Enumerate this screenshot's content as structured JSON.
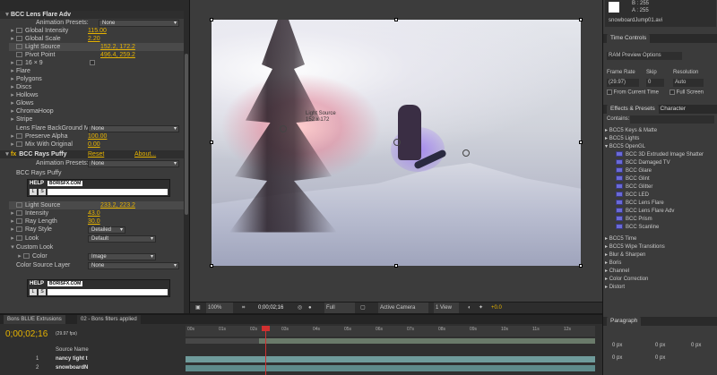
{
  "effects": {
    "bcc_flare_header": "BCC Lens Flare Adv",
    "animation_presets_label": "Animation Presets:",
    "animation_presets_value": "None",
    "global_intensity": {
      "label": "Global Intensity",
      "value": "115.00"
    },
    "global_scale": {
      "label": "Global Scale",
      "value": "2.20"
    },
    "light_source": {
      "label": "Light Source",
      "value": "152.2, 172.2"
    },
    "pivot_point": {
      "label": "Pivot Point",
      "value": "496.4, 259.2"
    },
    "aspect": {
      "label": "16 × 9"
    },
    "groups": [
      "Flare",
      "Polygons",
      "Discs",
      "Hollows",
      "Glows",
      "ChromaHoop",
      "Stripe"
    ],
    "lens_flare_bg_map": {
      "label": "Lens Flare BackGround Map",
      "value": "None"
    },
    "preserve_alpha": {
      "label": "Preserve Alpha",
      "value": "100.00"
    },
    "mix_with_original": {
      "label": "Mix With Original",
      "value": "0.00"
    },
    "rays_header": "BCC Rays Puffy",
    "reset": "Reset",
    "about": "About...",
    "rays_presets_value": "None",
    "rays_sub": "BCC Rays Puffy",
    "help": "HELP",
    "site": "BORISFX.COM",
    "rays_light_source": {
      "label": "Light Source",
      "value": "233.2, 223.2"
    },
    "intensity": {
      "label": "Intensity",
      "value": "43.0"
    },
    "ray_length": {
      "label": "Ray Length",
      "value": "30.0"
    },
    "ray_style": {
      "label": "Ray Style",
      "value": "Detailed"
    },
    "look": {
      "label": "Look",
      "value": "Default"
    },
    "custom_look": "Custom Look",
    "color": {
      "label": "Color",
      "value": "Image"
    },
    "color_source_layer": {
      "label": "Color Source Layer",
      "value": "None"
    }
  },
  "viewer": {
    "ls_label": "Light Source",
    "ls_value": "152 x 172",
    "zoom": "100%",
    "timecode": "0;00;02;16",
    "resolution": "Full",
    "camera": "Active Camera",
    "view": "1 View",
    "exposure": "+0.0"
  },
  "right": {
    "info_b": "B : 255",
    "info_a": "A : 255",
    "filename": "snowboardJump01.avi",
    "time_controls": "Time Controls",
    "ram_preview": "RAM Preview Options",
    "frame_rate_label": "Frame Rate",
    "skip_label": "Skip",
    "resolution_label": "Resolution",
    "frame_rate": "(29.97)",
    "skip": "0",
    "resolution": "Auto",
    "from_current": "From Current Time",
    "full_screen": "Full Screen",
    "effects_presets": "Effects & Presets",
    "character": "Character",
    "contains": "Contains:",
    "categories_top": [
      "BCC5 Keys & Matte",
      "BCC5 Lights",
      "BCC5 OpenGL"
    ],
    "opengl_items": [
      "BCC 3D Extruded Image Shatter",
      "BCC Damaged TV",
      "BCC Glare",
      "BCC Glint",
      "BCC Glitter",
      "BCC LED",
      "BCC Lens Flare",
      "BCC Lens Flare Adv",
      "BCC Prism",
      "BCC Scanline"
    ],
    "categories_bottom": [
      "BCC5 Time",
      "BCC5 Wipe Transitions",
      "Blur & Sharpen",
      "Boris",
      "Channel",
      "Color Correction",
      "Distort"
    ],
    "paragraph": "Paragraph",
    "px": "0 px"
  },
  "timeline": {
    "tab1": "Bons BLUE Extrusions",
    "tab2": "02 - Bons filters applied",
    "timecode": "0;00;02;16",
    "fps": "(29.97 fps)",
    "source_name": "Source Name",
    "ruler": [
      "00s",
      "01s",
      "02s",
      "03s",
      "04s",
      "05s",
      "06s",
      "07s",
      "08s",
      "09s",
      "10s",
      "11s",
      "12s"
    ],
    "layers": [
      {
        "num": "1",
        "name": "nancy tight t"
      },
      {
        "num": "2",
        "name": "snowboardN"
      }
    ]
  }
}
